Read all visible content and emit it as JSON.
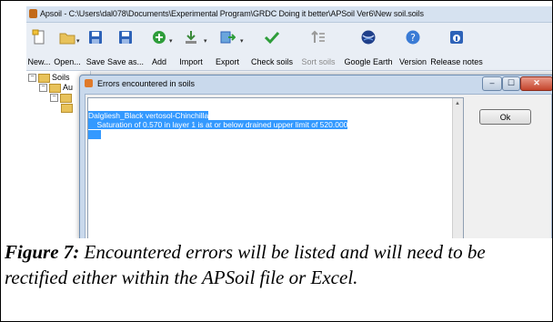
{
  "window": {
    "title": "Apsoil - C:\\Users\\dal078\\Documents\\Experimental Program\\GRDC Doing it better\\APSoil Ver6\\New soil.soils"
  },
  "toolbar": {
    "buttons": [
      {
        "label": "New...",
        "icon": "new-file-icon"
      },
      {
        "label": "Open...",
        "icon": "folder-open-icon"
      },
      {
        "label": "Save",
        "icon": "save-icon"
      },
      {
        "label": "Save as...",
        "icon": "save-as-icon"
      },
      {
        "label": "Add",
        "icon": "add-icon"
      },
      {
        "label": "Import",
        "icon": "import-icon"
      },
      {
        "label": "Export",
        "icon": "export-icon"
      },
      {
        "label": "Check soils",
        "icon": "checkmark-icon"
      },
      {
        "label": "Sort soils",
        "icon": "sort-icon"
      },
      {
        "label": "Google Earth",
        "icon": "globe-icon"
      },
      {
        "label": "Version",
        "icon": "help-icon"
      },
      {
        "label": "Release notes",
        "icon": "info-icon"
      }
    ]
  },
  "tree": {
    "items": [
      {
        "label": "Soils"
      },
      {
        "label": "Au"
      }
    ]
  },
  "dialog": {
    "title": "Errors encountered in soils",
    "errors": [
      "Dalgliesh_Black vertosol-Chinchilla",
      "    Saturation of 0.570 in layer 1 is at or below drained upper limit of 520.000"
    ],
    "ok_label": "Ok",
    "min_symbol": "–",
    "max_symbol": "☐",
    "close_symbol": "✕"
  },
  "caption": {
    "label": "Figure 7:",
    "text": " Encountered errors will be listed and will need to be rectified either within the APSoil file or Excel."
  }
}
